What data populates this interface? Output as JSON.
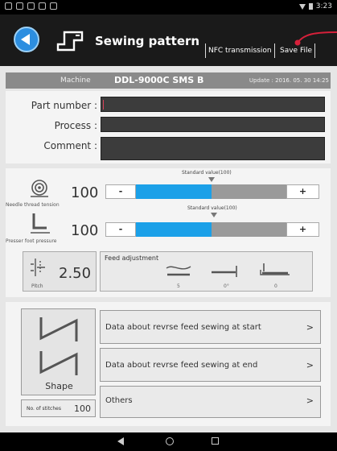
{
  "status_bar": {
    "time": "3:23",
    "left_icons": [
      "notification-icon",
      "notification-icon",
      "check-icon",
      "sd-card-icon",
      "android-icon"
    ],
    "right_icons": [
      "wifi-icon",
      "battery-icon"
    ]
  },
  "header": {
    "title": "Sewing pattern",
    "back_icon": "back-arrow-icon",
    "app_icon": "sewing-machine-icon",
    "nfc_label": "NFC transmission",
    "save_label": "Save File",
    "accent_color": "#2c8ee0"
  },
  "machine_bar": {
    "label": "Machine",
    "name": "DDL-9000C SMS B",
    "update": "Update : 2016. 05. 30  14:25"
  },
  "info_fields": [
    {
      "label": "Part number :",
      "value": ""
    },
    {
      "label": "Process :",
      "value": ""
    },
    {
      "label": "Comment :",
      "value": ""
    }
  ],
  "params": {
    "thread_tension": {
      "icon": "thread-tension-icon",
      "label": "Needle thread tension",
      "value": "100",
      "std_label": "Standard value(100)",
      "minus": "-",
      "plus": "+",
      "fill_fraction": 0.5
    },
    "presser_pressure": {
      "icon": "presser-foot-icon",
      "label": "Presser foot pressure",
      "value": "100",
      "std_label": "Standard value(100)",
      "minus": "-",
      "plus": "+",
      "fill_fraction": 0.5
    },
    "pitch": {
      "icon": "stitch-pitch-icon",
      "label": "Pitch",
      "value": "2.50"
    },
    "feed_adjustment": {
      "title": "Feed adjustment",
      "values": [
        "5",
        "0°",
        "0"
      ],
      "icons": [
        "feed-dog-height-icon",
        "feed-timing-icon",
        "feed-tilt-icon"
      ]
    }
  },
  "shape": {
    "icon": "n-shape-pattern-icon",
    "label": "Shape",
    "stitches_label": "No. of stitches",
    "stitches_value": "100"
  },
  "menu": [
    {
      "label": "Data about revrse feed sewing at start",
      "chevron": ">"
    },
    {
      "label": "Data about revrse feed sewing at end",
      "chevron": ">"
    },
    {
      "label": "Others",
      "chevron": ">"
    }
  ],
  "colors": {
    "bar_fill": "#1ba0e8",
    "bar_bg": "#9a9a9a",
    "caret": "#d9425a",
    "pointer": "#d6203a"
  }
}
